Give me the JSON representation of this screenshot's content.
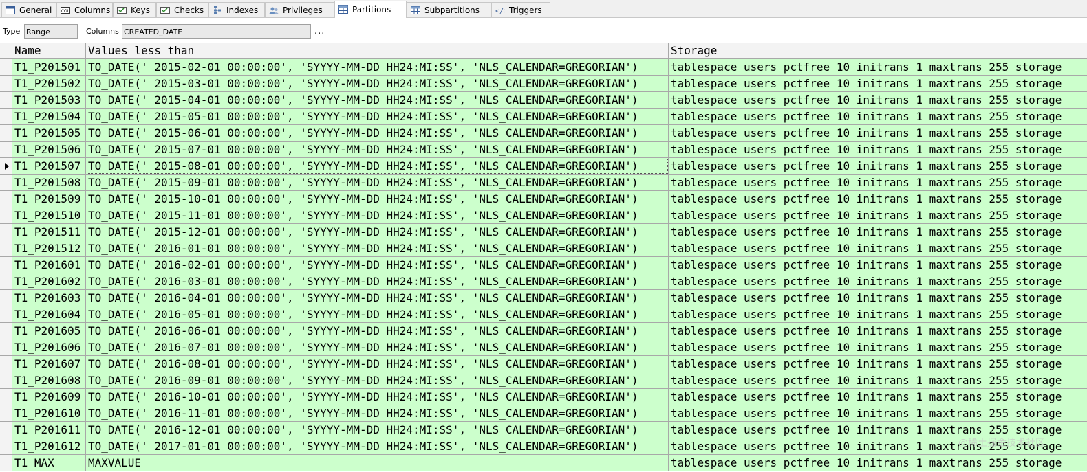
{
  "tabs": [
    {
      "label": "General",
      "icon": "general-tab-icon",
      "active": false
    },
    {
      "label": "Columns",
      "icon": "columns-tab-icon",
      "active": false
    },
    {
      "label": "Keys",
      "icon": "keys-tab-icon",
      "active": false
    },
    {
      "label": "Checks",
      "icon": "checks-tab-icon",
      "active": false
    },
    {
      "label": "Indexes",
      "icon": "indexes-tab-icon",
      "active": false
    },
    {
      "label": "Privileges",
      "icon": "privileges-tab-icon",
      "active": false
    },
    {
      "label": "Partitions",
      "icon": "partitions-tab-icon",
      "active": true
    },
    {
      "label": "Subpartitions",
      "icon": "subpartitions-tab-icon",
      "active": false
    },
    {
      "label": "Triggers",
      "icon": "triggers-tab-icon",
      "active": false
    }
  ],
  "options": {
    "type_label": "Type",
    "type_value": "Range",
    "columns_label": "Columns",
    "columns_value": "CREATED_DATE",
    "ellipsis": "..."
  },
  "grid": {
    "headers": {
      "name": "Name",
      "values": "Values less than",
      "storage": "Storage"
    },
    "selected_index": 6,
    "row_color": "#ccffcc",
    "rows": [
      {
        "name": "T1_P201501",
        "values": "TO_DATE(' 2015-02-01 00:00:00', 'SYYYY-MM-DD HH24:MI:SS', 'NLS_CALENDAR=GREGORIAN')",
        "storage": "tablespace users pctfree 10 initrans 1 maxtrans 255 storage"
      },
      {
        "name": "T1_P201502",
        "values": "TO_DATE(' 2015-03-01 00:00:00', 'SYYYY-MM-DD HH24:MI:SS', 'NLS_CALENDAR=GREGORIAN')",
        "storage": "tablespace users pctfree 10 initrans 1 maxtrans 255 storage"
      },
      {
        "name": "T1_P201503",
        "values": "TO_DATE(' 2015-04-01 00:00:00', 'SYYYY-MM-DD HH24:MI:SS', 'NLS_CALENDAR=GREGORIAN')",
        "storage": "tablespace users pctfree 10 initrans 1 maxtrans 255 storage"
      },
      {
        "name": "T1_P201504",
        "values": "TO_DATE(' 2015-05-01 00:00:00', 'SYYYY-MM-DD HH24:MI:SS', 'NLS_CALENDAR=GREGORIAN')",
        "storage": "tablespace users pctfree 10 initrans 1 maxtrans 255 storage"
      },
      {
        "name": "T1_P201505",
        "values": "TO_DATE(' 2015-06-01 00:00:00', 'SYYYY-MM-DD HH24:MI:SS', 'NLS_CALENDAR=GREGORIAN')",
        "storage": "tablespace users pctfree 10 initrans 1 maxtrans 255 storage"
      },
      {
        "name": "T1_P201506",
        "values": "TO_DATE(' 2015-07-01 00:00:00', 'SYYYY-MM-DD HH24:MI:SS', 'NLS_CALENDAR=GREGORIAN')",
        "storage": "tablespace users pctfree 10 initrans 1 maxtrans 255 storage"
      },
      {
        "name": "T1_P201507",
        "values": "TO_DATE(' 2015-08-01 00:00:00', 'SYYYY-MM-DD HH24:MI:SS', 'NLS_CALENDAR=GREGORIAN')",
        "storage": "tablespace users pctfree 10 initrans 1 maxtrans 255 storage"
      },
      {
        "name": "T1_P201508",
        "values": "TO_DATE(' 2015-09-01 00:00:00', 'SYYYY-MM-DD HH24:MI:SS', 'NLS_CALENDAR=GREGORIAN')",
        "storage": "tablespace users pctfree 10 initrans 1 maxtrans 255 storage"
      },
      {
        "name": "T1_P201509",
        "values": "TO_DATE(' 2015-10-01 00:00:00', 'SYYYY-MM-DD HH24:MI:SS', 'NLS_CALENDAR=GREGORIAN')",
        "storage": "tablespace users pctfree 10 initrans 1 maxtrans 255 storage"
      },
      {
        "name": "T1_P201510",
        "values": "TO_DATE(' 2015-11-01 00:00:00', 'SYYYY-MM-DD HH24:MI:SS', 'NLS_CALENDAR=GREGORIAN')",
        "storage": "tablespace users pctfree 10 initrans 1 maxtrans 255 storage"
      },
      {
        "name": "T1_P201511",
        "values": "TO_DATE(' 2015-12-01 00:00:00', 'SYYYY-MM-DD HH24:MI:SS', 'NLS_CALENDAR=GREGORIAN')",
        "storage": "tablespace users pctfree 10 initrans 1 maxtrans 255 storage"
      },
      {
        "name": "T1_P201512",
        "values": "TO_DATE(' 2016-01-01 00:00:00', 'SYYYY-MM-DD HH24:MI:SS', 'NLS_CALENDAR=GREGORIAN')",
        "storage": "tablespace users pctfree 10 initrans 1 maxtrans 255 storage"
      },
      {
        "name": "T1_P201601",
        "values": "TO_DATE(' 2016-02-01 00:00:00', 'SYYYY-MM-DD HH24:MI:SS', 'NLS_CALENDAR=GREGORIAN')",
        "storage": "tablespace users pctfree 10 initrans 1 maxtrans 255 storage"
      },
      {
        "name": "T1_P201602",
        "values": "TO_DATE(' 2016-03-01 00:00:00', 'SYYYY-MM-DD HH24:MI:SS', 'NLS_CALENDAR=GREGORIAN')",
        "storage": "tablespace users pctfree 10 initrans 1 maxtrans 255 storage"
      },
      {
        "name": "T1_P201603",
        "values": "TO_DATE(' 2016-04-01 00:00:00', 'SYYYY-MM-DD HH24:MI:SS', 'NLS_CALENDAR=GREGORIAN')",
        "storage": "tablespace users pctfree 10 initrans 1 maxtrans 255 storage"
      },
      {
        "name": "T1_P201604",
        "values": "TO_DATE(' 2016-05-01 00:00:00', 'SYYYY-MM-DD HH24:MI:SS', 'NLS_CALENDAR=GREGORIAN')",
        "storage": "tablespace users pctfree 10 initrans 1 maxtrans 255 storage"
      },
      {
        "name": "T1_P201605",
        "values": "TO_DATE(' 2016-06-01 00:00:00', 'SYYYY-MM-DD HH24:MI:SS', 'NLS_CALENDAR=GREGORIAN')",
        "storage": "tablespace users pctfree 10 initrans 1 maxtrans 255 storage"
      },
      {
        "name": "T1_P201606",
        "values": "TO_DATE(' 2016-07-01 00:00:00', 'SYYYY-MM-DD HH24:MI:SS', 'NLS_CALENDAR=GREGORIAN')",
        "storage": "tablespace users pctfree 10 initrans 1 maxtrans 255 storage"
      },
      {
        "name": "T1_P201607",
        "values": "TO_DATE(' 2016-08-01 00:00:00', 'SYYYY-MM-DD HH24:MI:SS', 'NLS_CALENDAR=GREGORIAN')",
        "storage": "tablespace users pctfree 10 initrans 1 maxtrans 255 storage"
      },
      {
        "name": "T1_P201608",
        "values": "TO_DATE(' 2016-09-01 00:00:00', 'SYYYY-MM-DD HH24:MI:SS', 'NLS_CALENDAR=GREGORIAN')",
        "storage": "tablespace users pctfree 10 initrans 1 maxtrans 255 storage"
      },
      {
        "name": "T1_P201609",
        "values": "TO_DATE(' 2016-10-01 00:00:00', 'SYYYY-MM-DD HH24:MI:SS', 'NLS_CALENDAR=GREGORIAN')",
        "storage": "tablespace users pctfree 10 initrans 1 maxtrans 255 storage"
      },
      {
        "name": "T1_P201610",
        "values": "TO_DATE(' 2016-11-01 00:00:00', 'SYYYY-MM-DD HH24:MI:SS', 'NLS_CALENDAR=GREGORIAN')",
        "storage": "tablespace users pctfree 10 initrans 1 maxtrans 255 storage"
      },
      {
        "name": "T1_P201611",
        "values": "TO_DATE(' 2016-12-01 00:00:00', 'SYYYY-MM-DD HH24:MI:SS', 'NLS_CALENDAR=GREGORIAN')",
        "storage": "tablespace users pctfree 10 initrans 1 maxtrans 255 storage"
      },
      {
        "name": "T1_P201612",
        "values": "TO_DATE(' 2017-01-01 00:00:00', 'SYYYY-MM-DD HH24:MI:SS', 'NLS_CALENDAR=GREGORIAN')",
        "storage": "tablespace users pctfree 10 initrans 1 maxtrans 255 storage"
      },
      {
        "name": "T1_MAX",
        "values": "MAXVALUE",
        "storage": "tablespace users pctfree 10 initrans 1 maxtrans 255 storage"
      }
    ]
  },
  "watermark": "@稀土掘金技术社区"
}
